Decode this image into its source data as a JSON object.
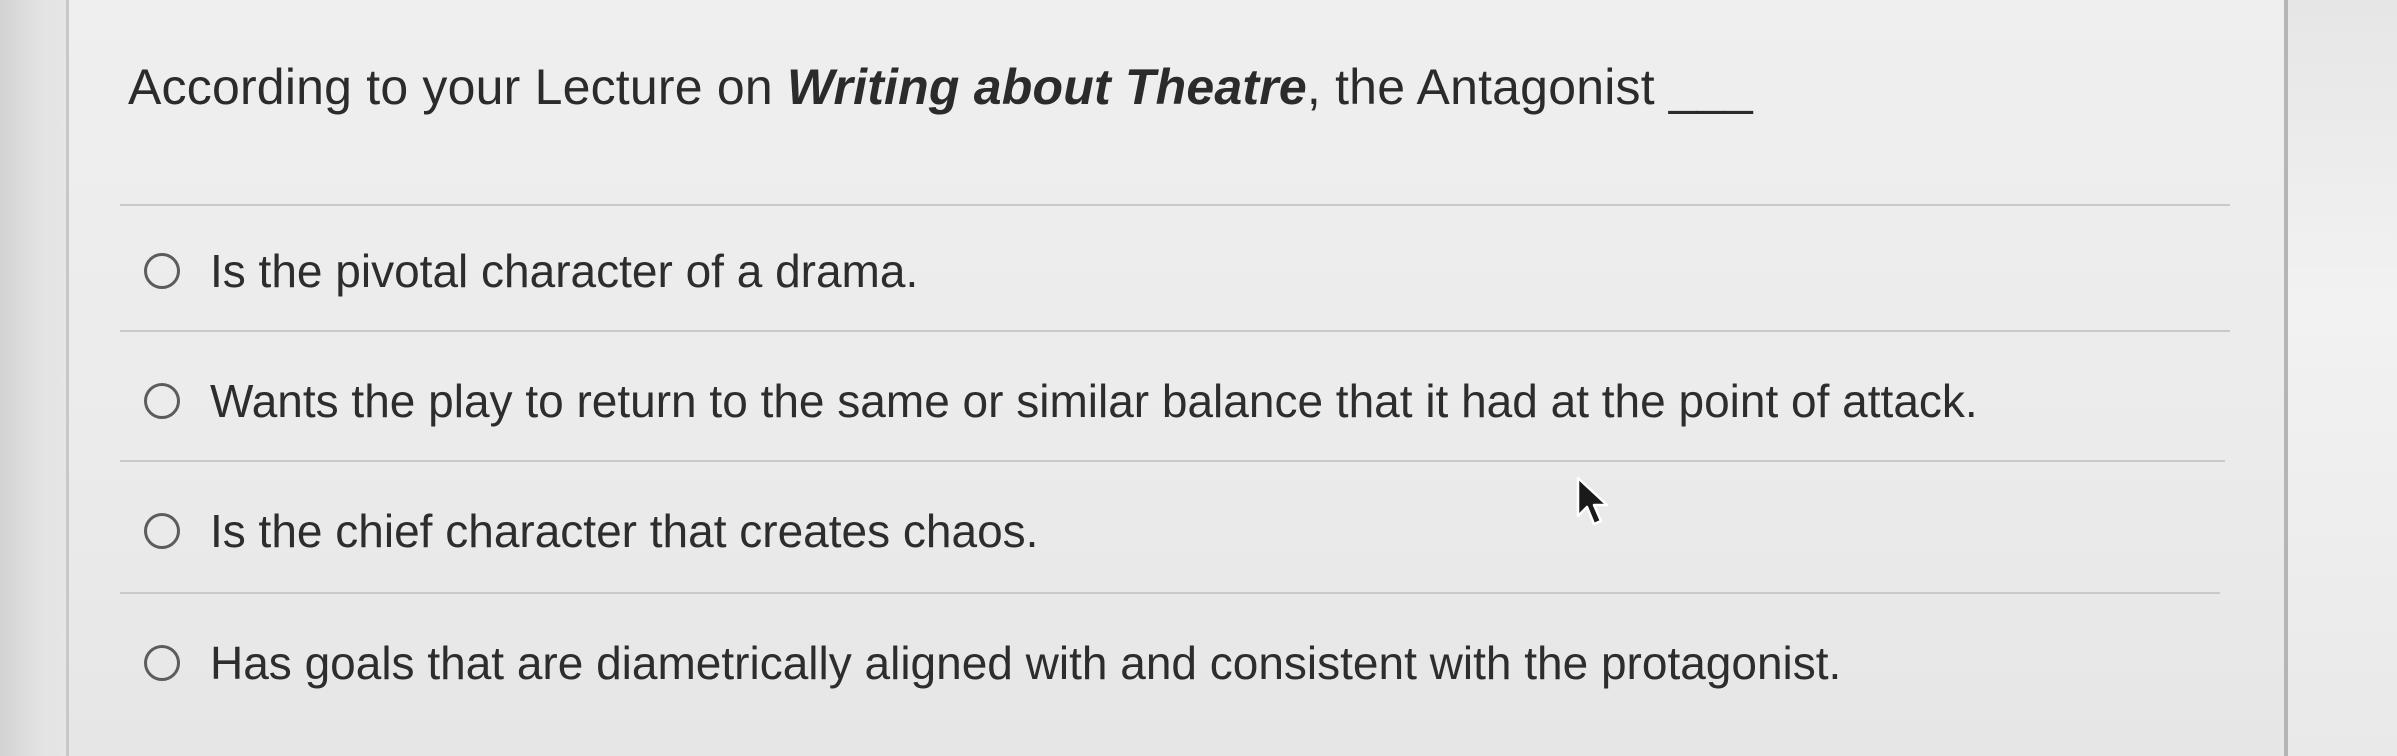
{
  "question": {
    "prefix": "According to your Lecture on ",
    "emphasis": "Writing about Theatre",
    "suffix": ", the Antagonist ___"
  },
  "options": [
    {
      "label": "Is the pivotal character of a drama.",
      "selected": false
    },
    {
      "label": "Wants the play to return to the same or similar balance that it had at the point of attack.",
      "selected": false
    },
    {
      "label": "Is the chief character that creates chaos.",
      "selected": false
    },
    {
      "label": "Has goals that are diametrically aligned with and consistent with the protagonist.",
      "selected": false
    }
  ],
  "icons": {
    "radio": "radio-unselected-icon",
    "cursor": "mouse-pointer-icon"
  },
  "colors": {
    "text": "#2b2b2b",
    "radio_border": "#5c5c5c",
    "divider": "#c9c9c9"
  }
}
